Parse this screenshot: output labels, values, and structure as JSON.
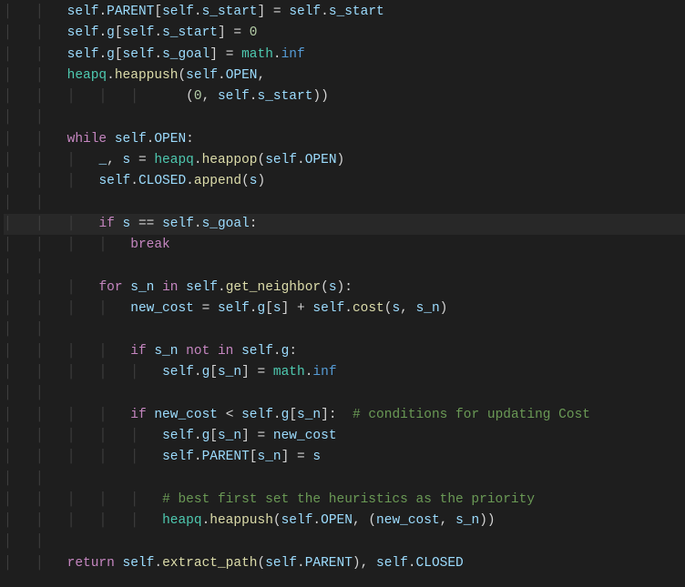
{
  "code": {
    "lines": [
      "self.PARENT[self.s_start] = self.s_start",
      "self.g[self.s_start] = 0",
      "self.g[self.s_goal] = math.inf",
      "heapq.heappush(self.OPEN,",
      "               (0, self.s_start))",
      "",
      "while self.OPEN:",
      "    _, s = heapq.heappop(self.OPEN)",
      "    self.CLOSED.append(s)",
      "",
      "    if s == self.s_goal:",
      "        break",
      "",
      "    for s_n in self.get_neighbor(s):",
      "        new_cost = self.g[s] + self.cost(s, s_n)",
      "",
      "        if s_n not in self.g:",
      "            self.g[s_n] = math.inf",
      "",
      "        if new_cost < self.g[s_n]:  # conditions for updating Cost",
      "            self.g[s_n] = new_cost",
      "            self.PARENT[s_n] = s",
      "",
      "            # best first set the heuristics as the priority",
      "            heapq.heappush(self.OPEN, (new_cost, s_n))",
      "",
      "return self.extract_path(self.PARENT), self.CLOSED"
    ],
    "base_indent": 2,
    "highlighted_line_index": 10,
    "comments": {
      "inline": "# conditions for updating Cost",
      "standalone": "# best first set the heuristics as the priority"
    }
  },
  "tokens": {
    "keywords": [
      "while",
      "if",
      "for",
      "in",
      "not",
      "break",
      "return"
    ],
    "self": "self",
    "modules": [
      "heapq",
      "math"
    ],
    "constants": [
      "inf"
    ],
    "numbers": [
      "0"
    ],
    "identifiers": [
      "PARENT",
      "g",
      "OPEN",
      "CLOSED",
      "s_start",
      "s_goal",
      "s",
      "s_n",
      "new_cost",
      "_"
    ],
    "functions": [
      "heappush",
      "heappop",
      "append",
      "get_neighbor",
      "cost",
      "extract_path"
    ]
  },
  "colors": {
    "background": "#1e1e1e",
    "foreground": "#d4d4d4",
    "keyword": "#c586c0",
    "variable": "#9cdcfe",
    "function": "#dcdcaa",
    "number": "#b5cea8",
    "type": "#4ec9b0",
    "constant": "#569cd6",
    "comment": "#6a9955",
    "guide": "#404040",
    "highlight_bg": "#282828"
  }
}
